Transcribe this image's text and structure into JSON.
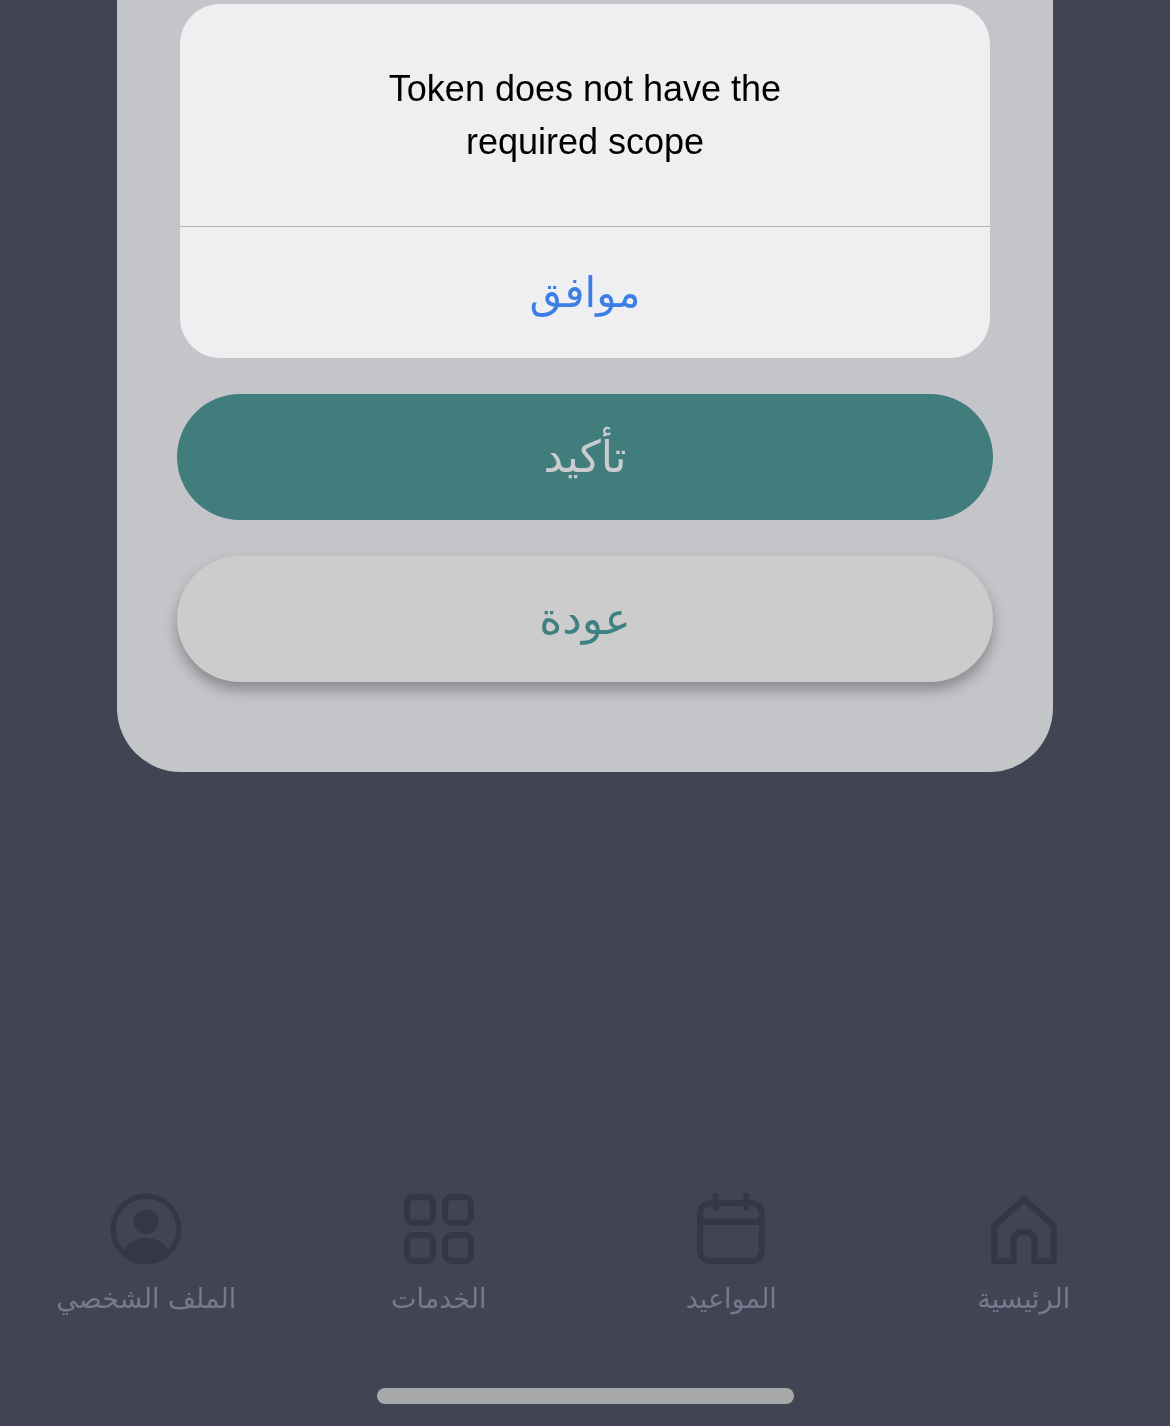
{
  "alert": {
    "message": "Token does not have the required scope",
    "button": "موافق"
  },
  "dialog": {
    "buttons": [
      {
        "label": "تأكيد",
        "kind": "primary"
      },
      {
        "label": "عودة",
        "kind": "secondary"
      }
    ]
  },
  "tab_bar": {
    "tabs": [
      {
        "label": "الرئيسية",
        "kind": "home"
      },
      {
        "label": "المواعيد",
        "kind": "calendar"
      },
      {
        "label": "الخدمات",
        "kind": "grid"
      },
      {
        "label": "الملف الشخصي",
        "kind": "profile"
      }
    ]
  }
}
